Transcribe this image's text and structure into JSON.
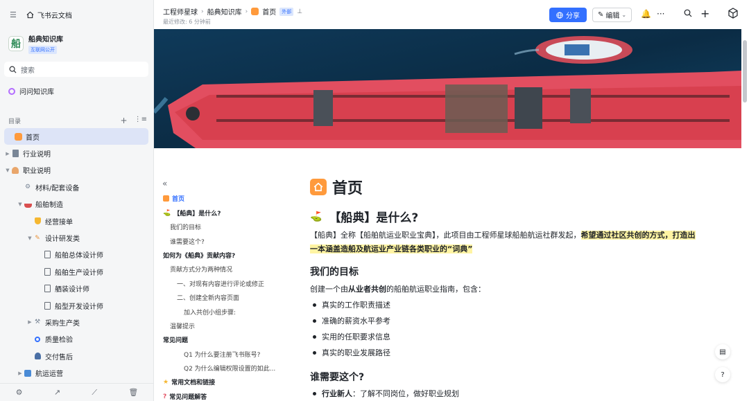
{
  "sidebar": {
    "app_title": "飞书云文档",
    "kb_name": "船典知识库",
    "kb_logo": "船",
    "kb_badge": "互联网公开",
    "search_placeholder": "搜索",
    "ask": "问问知识库",
    "toc_label": "目录",
    "items": [
      {
        "label": "首页",
        "icon": "home-orange-icon"
      },
      {
        "label": "行业说明",
        "icon": "building-icon"
      },
      {
        "label": "职业说明",
        "icon": "worker-icon"
      },
      {
        "label": "材料/配套设备",
        "icon": "gear-icon"
      },
      {
        "label": "船舶制造",
        "icon": "ship-icon"
      },
      {
        "label": "经营接单",
        "icon": "shield-icon"
      },
      {
        "label": "设计研发类",
        "icon": "pencil-icon"
      },
      {
        "label": "船舶总体设计师",
        "icon": "doc-icon"
      },
      {
        "label": "船舶生产设计师",
        "icon": "doc-icon"
      },
      {
        "label": "舾装设计师",
        "icon": "doc-icon"
      },
      {
        "label": "船型开发设计师",
        "icon": "doc-icon"
      },
      {
        "label": "采购生产类",
        "icon": "tools-icon"
      },
      {
        "label": "质量检验",
        "icon": "magnifier-icon"
      },
      {
        "label": "交付售后",
        "icon": "person-icon"
      },
      {
        "label": "航运运营",
        "icon": "chart-icon"
      }
    ]
  },
  "topbar": {
    "crumbs": [
      "工程师星球",
      "船典知识库",
      "首页"
    ],
    "ext_badge": "外部",
    "last_modified": "最近修改: 6 分钟前",
    "share": "分享",
    "edit": "编辑"
  },
  "toc": {
    "items": [
      "首页",
      "【船典】是什么?",
      "我们的目标",
      "谁需要这个?",
      "如何为《船典》贡献内容?",
      "贡献方式分为两种情况",
      "一、对现有内容进行评论或修正",
      "二、创建全新内容页面",
      "加入共创小组步骤:",
      "温馨提示",
      "常见问题",
      "Q1 为什么要注册飞书账号?",
      "Q2 为什么编辑权限设置的如此...",
      "常用文档和链接",
      "常见问题解答"
    ]
  },
  "doc": {
    "title": "首页",
    "h_what": "【船典】是什么?",
    "intro_a": "【船典】全称【船舶航运业职业宝典】，此项目由工程师星球船舶航运社群发起，",
    "intro_b": "希望通过社区共创的方式，打造出一本涵盖造船及航运业产业链各类职业的“词典”",
    "h_goal": "我们的目标",
    "goal_a": "创建一个由",
    "goal_b": "从业者共创",
    "goal_c": "的船舶航运职业指南，包含：",
    "bullets": [
      "真实的工作职责描述",
      "准确的薪资水平参考",
      "实用的任职要求信息",
      "真实的职业发展路径"
    ],
    "h_who": "谁需要这个?",
    "who_b": "行业新人",
    "who_t": "：了解不同岗位，做好职业规划"
  }
}
